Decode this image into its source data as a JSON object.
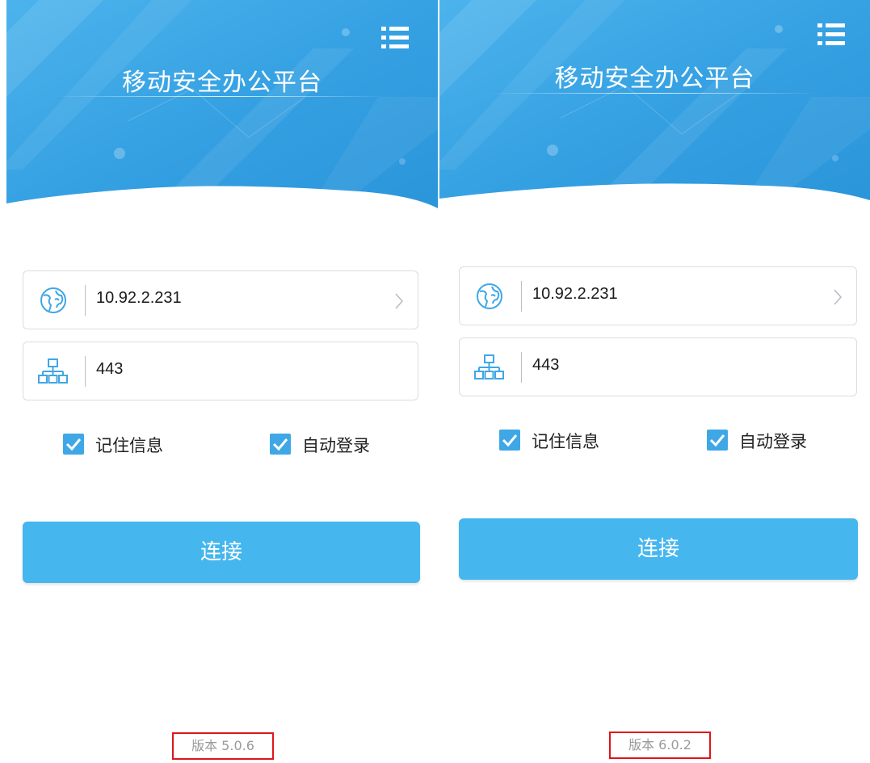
{
  "colors": {
    "header_blue": "#3aa3e3",
    "accent": "#45b6ee",
    "checkbox": "#3fa7e6",
    "highlight_border": "#e0141b"
  },
  "screens": [
    {
      "title": "移动安全办公平台",
      "menu_icon": "list-menu-icon",
      "server_address": "10.92.2.231",
      "server_icon": "globe-icon",
      "port": "443",
      "port_icon": "network-topology-icon",
      "remember_label": "记住信息",
      "remember_checked": true,
      "auto_login_label": "自动登录",
      "auto_login_checked": true,
      "connect_label": "连接",
      "version": "版本 5.0.6"
    },
    {
      "title": "移动安全办公平台",
      "menu_icon": "list-menu-icon",
      "server_address": "10.92.2.231",
      "server_icon": "globe-icon",
      "port": "443",
      "port_icon": "network-topology-icon",
      "remember_label": "记住信息",
      "remember_checked": true,
      "auto_login_label": "自动登录",
      "auto_login_checked": true,
      "connect_label": "连接",
      "version": "版本 6.0.2"
    }
  ]
}
